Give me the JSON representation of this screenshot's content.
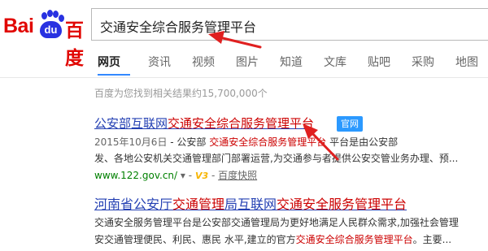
{
  "logo": {
    "left_text": "Bai",
    "paw_text": "du",
    "right_text": "百度"
  },
  "search": {
    "query": "交通安全综合服务管理平台"
  },
  "nav": {
    "tabs": [
      "网页",
      "资讯",
      "视频",
      "图片",
      "知道",
      "文库",
      "贴吧",
      "采购",
      "地图"
    ],
    "active": "网页"
  },
  "results_count": "百度为您找到相关结果约15,700,000个",
  "result1": {
    "title_prefix": "公安部互联网",
    "title_highlight": "交通安全综合服务管理平台",
    "badge": "官网",
    "date": "2015年10月6日",
    "line1_a": " - 公安部 ",
    "line1_hl": "交通安全综合服务管理平台",
    "line1_b": " 平台是由公安部",
    "line2": "发、各地公安机关交通管理部门部署运营,为交通参与者提供公安交管业务办理、预...",
    "url": "www.122.gov.cn/",
    "v3": "V3",
    "cache": "百度快照"
  },
  "result2": {
    "title_a": "河南省公安厅",
    "title_hl1": "交通管理",
    "title_b": "局互联网",
    "title_hl2": "交通安全服务管理平台",
    "line1": "交通安全服务管理平台是公安部交通管理局为更好地满足人民群众需求,加强社会管理",
    "line2_a": "安交通管理便民、利民、惠民 水平,建立的官方",
    "line2_hl": "交通安全综合服务管理平台",
    "line2_b": "。主要..."
  }
}
